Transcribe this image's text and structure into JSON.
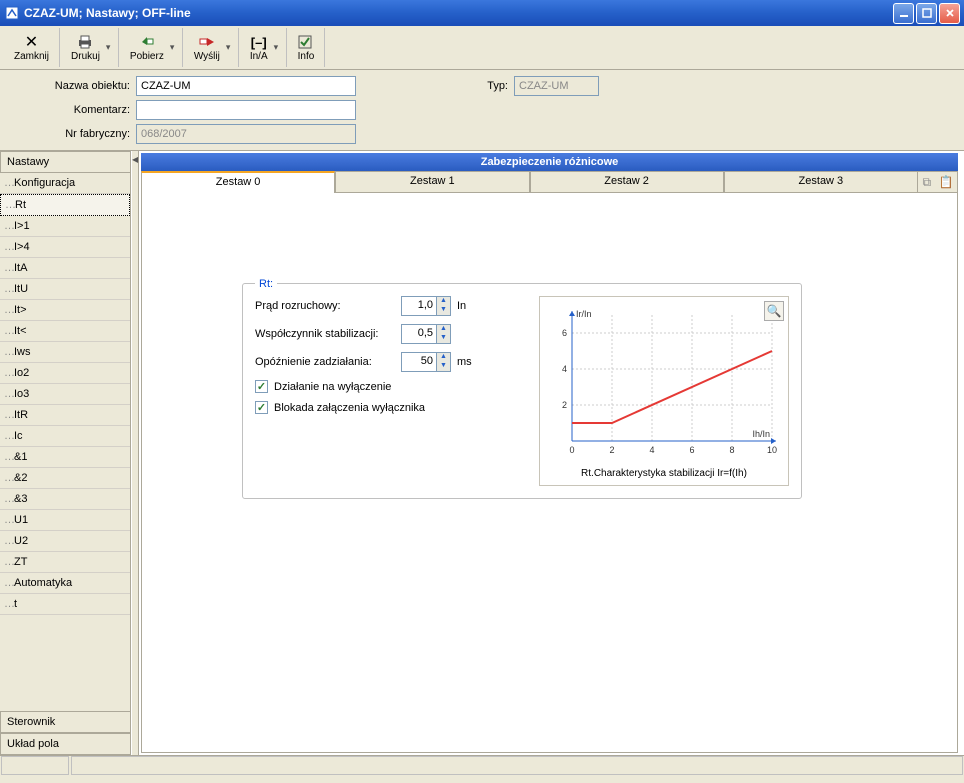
{
  "window": {
    "title": "CZAZ-UM; Nastawy; OFF-line"
  },
  "toolbar": {
    "close": "Zamknij",
    "print": "Drukuj",
    "download": "Pobierz",
    "send": "Wyślij",
    "ina": "In/A",
    "info": "Info"
  },
  "form": {
    "object_name_label": "Nazwa obiektu:",
    "object_name": "CZAZ-UM",
    "type_label": "Typ:",
    "type": "CZAZ-UM",
    "comment_label": "Komentarz:",
    "comment": "",
    "serial_label": "Nr fabryczny:",
    "serial": "068/2007"
  },
  "sidebar": {
    "headers": {
      "nastawy": "Nastawy",
      "sterownik": "Sterownik",
      "uklad_pola": "Układ pola"
    },
    "items": [
      "Konfiguracja",
      "Rt",
      "I>1",
      "I>4",
      "ItA",
      "ItU",
      "It>",
      "It<",
      "Iws",
      "Io2",
      "Io3",
      "ItR",
      "Ic",
      "&1",
      "&2",
      "&3",
      "U1",
      "U2",
      "ZT",
      "Automatyka",
      "t"
    ],
    "selected_index": 1
  },
  "content": {
    "header": "Zabezpieczenie różnicowe",
    "tabs": [
      "Zestaw 0",
      "Zestaw 1",
      "Zestaw 2",
      "Zestaw 3"
    ],
    "active_tab": 0
  },
  "rt": {
    "title": "Rt:",
    "params": {
      "startup_current_label": "Prąd rozruchowy:",
      "startup_current_value": "1,0",
      "startup_current_unit": "In",
      "stab_factor_label": "Współczynnik stabilizacji:",
      "stab_factor_value": "0,5",
      "delay_label": "Opóźnienie zadziałania:",
      "delay_value": "50",
      "delay_unit": "ms"
    },
    "checks": {
      "trip_action": "Działanie na wyłączenie",
      "trip_action_checked": true,
      "breaker_block": "Blokada załączenia wyłącznika",
      "breaker_block_checked": true
    }
  },
  "chart_data": {
    "type": "line",
    "title": "Rt.Charakterystyka stabilizacji Ir=f(Ih)",
    "xlabel": "Ih/In",
    "ylabel": "Ir/In",
    "x_ticks": [
      0,
      2,
      4,
      6,
      8,
      10
    ],
    "y_ticks": [
      0,
      2,
      4,
      6
    ],
    "xlim": [
      0,
      10
    ],
    "ylim": [
      0,
      7
    ],
    "series": [
      {
        "name": "Rt",
        "color": "#e53935",
        "points": [
          [
            0,
            1
          ],
          [
            2,
            1
          ],
          [
            10,
            5
          ]
        ]
      }
    ]
  }
}
